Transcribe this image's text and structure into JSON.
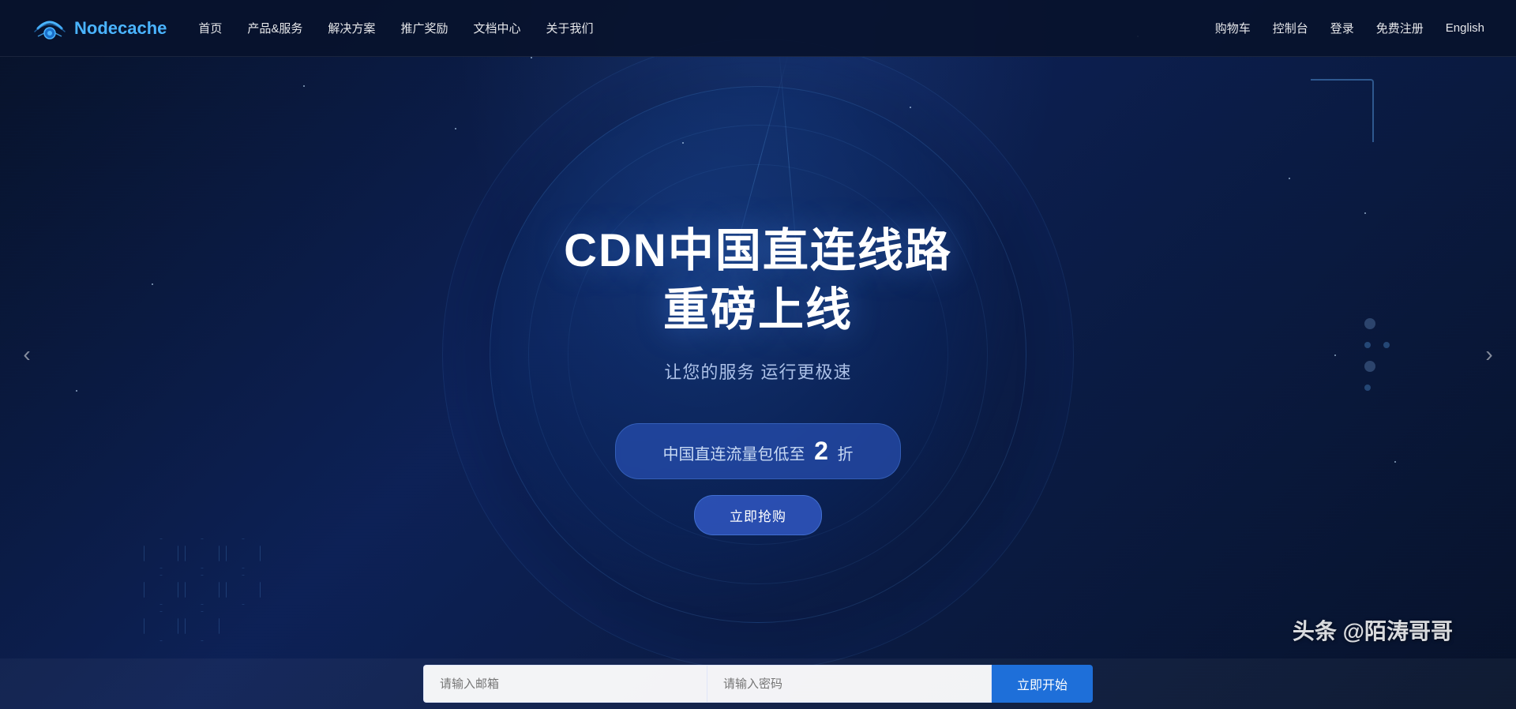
{
  "site": {
    "logo_text": "Nodecache",
    "logo_icon_alt": "nodecache-logo"
  },
  "navbar": {
    "links": [
      {
        "label": "首页",
        "id": "home"
      },
      {
        "label": "产品&服务",
        "id": "products"
      },
      {
        "label": "解决方案",
        "id": "solutions"
      },
      {
        "label": "推广奖励",
        "id": "promotions"
      },
      {
        "label": "文档中心",
        "id": "docs"
      },
      {
        "label": "关于我们",
        "id": "about"
      }
    ],
    "right_links": [
      {
        "label": "购物车",
        "id": "cart"
      },
      {
        "label": "控制台",
        "id": "console"
      },
      {
        "label": "登录",
        "id": "login"
      },
      {
        "label": "免费注册",
        "id": "register"
      },
      {
        "label": "English",
        "id": "lang"
      }
    ]
  },
  "hero": {
    "title_line1": "CDN中国直连线路",
    "title_line2": "重磅上线",
    "subtitle": "让您的服务 运行更极速",
    "promo_prefix": "中国直连流量包低至",
    "promo_highlight": "2",
    "promo_suffix": "折",
    "cta_label": "立即抢购",
    "carousel_left": "‹",
    "carousel_right": "›"
  },
  "form": {
    "email_placeholder": "请输入邮箱",
    "password_placeholder": "请输入密码",
    "submit_label": "立即开始"
  },
  "watermark": {
    "text": "头条 @陌涛哥哥"
  }
}
